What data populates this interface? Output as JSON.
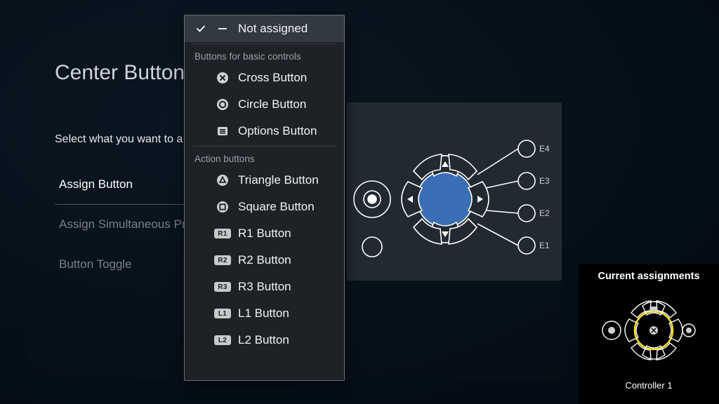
{
  "page": {
    "title": "Center Button",
    "prompt": "Select what you want to a"
  },
  "left_menu": {
    "items": [
      {
        "label": "Assign Button",
        "active": true
      },
      {
        "label": "Assign Simultaneous Pre",
        "active": false
      },
      {
        "label": "Button Toggle",
        "active": false
      }
    ]
  },
  "dropdown": {
    "selected_label": "Not assigned",
    "sections": [
      {
        "title": "Buttons for basic controls",
        "items": [
          {
            "label": "Cross Button",
            "icon": "cross"
          },
          {
            "label": "Circle Button",
            "icon": "circle"
          },
          {
            "label": "Options Button",
            "icon": "options"
          }
        ]
      },
      {
        "title": "Action buttons",
        "items": [
          {
            "label": "Triangle Button",
            "icon": "triangle"
          },
          {
            "label": "Square Button",
            "icon": "square"
          },
          {
            "label": "R1 Button",
            "icon": "R1"
          },
          {
            "label": "R2 Button",
            "icon": "R2"
          },
          {
            "label": "R3 Button",
            "icon": "R3"
          },
          {
            "label": "L1 Button",
            "icon": "L1"
          },
          {
            "label": "L2 Button",
            "icon": "L2"
          }
        ]
      }
    ]
  },
  "diagram": {
    "expansion_labels": [
      "E4",
      "E3",
      "E2",
      "E1"
    ]
  },
  "side_panel": {
    "title": "Current assignments",
    "subtitle": "Controller 1"
  }
}
